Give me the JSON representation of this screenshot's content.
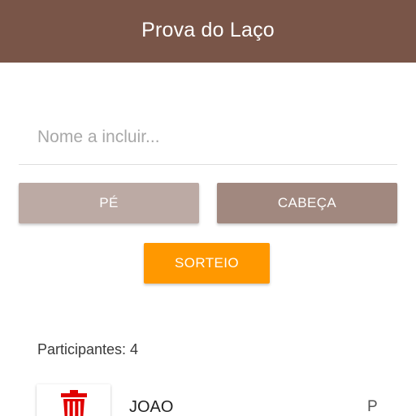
{
  "appbar": {
    "title": "Prova do Laço"
  },
  "form": {
    "name_placeholder": "Nome a incluir...",
    "name_value": ""
  },
  "buttons": {
    "pe_label": "PÉ",
    "cabeca_label": "CABEÇA",
    "sorteio_label": "SORTEIO"
  },
  "participants": {
    "count_label": "Participantes: 4",
    "items": [
      {
        "name": "JOAO",
        "position": "P",
        "action_icon": "trash-icon"
      }
    ]
  },
  "colors": {
    "appbar": "#795548",
    "pe_button": "#bcaaa4",
    "cabeca_button": "#a1887f",
    "sorteio_button": "#ff9800",
    "trash_icon": "#e00000"
  }
}
